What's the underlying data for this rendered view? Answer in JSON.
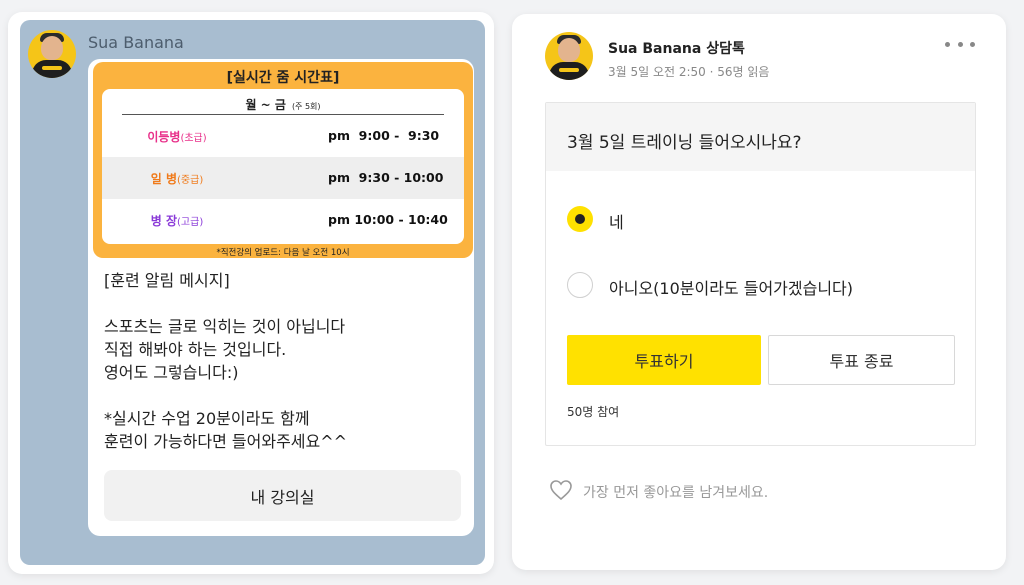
{
  "chat": {
    "sender_name": "Sua Banana",
    "timetable": {
      "title": "[실시간 줌 시간표]",
      "days": "월 ~ 금",
      "days_sub": "(주 5회)",
      "rows": [
        {
          "rank": "이등병",
          "level": "(초급)",
          "time": "pm  9:00 -  9:30",
          "color": "#e8308a"
        },
        {
          "rank": "일  병",
          "level": "(중급)",
          "time": "pm  9:30 - 10:00",
          "color": "#f07a1a"
        },
        {
          "rank": "병  장",
          "level": "(고급)",
          "time": "pm 10:00 - 10:40",
          "color": "#8a3ad8"
        }
      ],
      "note": "*직전강의 업로드: 다음 날 오전 10시"
    },
    "message": "[훈련 알림 메시지]\n\n스포츠는 글로 익히는 것이 아닙니다\n직접 해봐야 하는 것입니다.\n영어도 그렇습니다:)\n\n*실시간 수업 20분이라도 함께\n훈련이 가능하다면 들어와주세요^^",
    "button_label": "내 강의실"
  },
  "poll": {
    "author": "Sua Banana 상담톡",
    "meta": "3월 5일 오전 2:50 · 56명 읽음",
    "question": "3월 5일 트레이닝 들어오시나요?",
    "options": [
      {
        "label": "네",
        "selected": true
      },
      {
        "label": "아니오(10분이라도 들어가겠습니다)",
        "selected": false
      }
    ],
    "vote_label": "투표하기",
    "end_label": "투표 종료",
    "participants": "50명 참여",
    "like_prompt": "가장 먼저 좋아요를 남겨보세요."
  },
  "colors": {
    "chat_bg": "#a8bdd0",
    "timetable_bg": "#fbb33f",
    "accent_yellow": "#ffe100"
  },
  "icons": [
    "avatar",
    "more-icon",
    "radio-checked-icon",
    "radio-empty-icon",
    "heart-icon"
  ]
}
